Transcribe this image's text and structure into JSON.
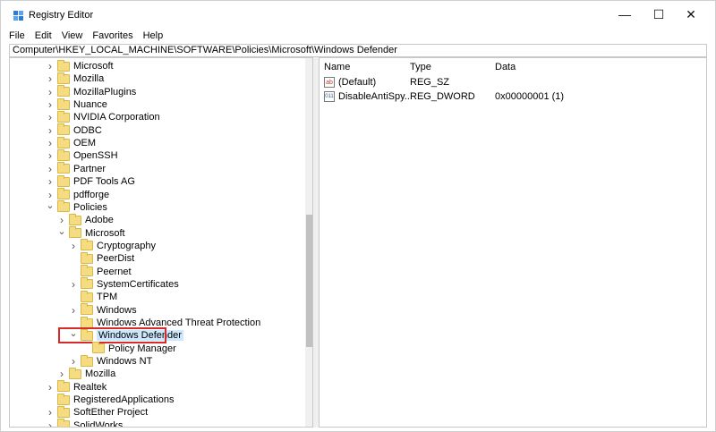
{
  "window": {
    "title": "Registry Editor",
    "controls": {
      "minimize": "—",
      "maximize": "☐",
      "close": "✕"
    }
  },
  "menu": [
    "File",
    "Edit",
    "View",
    "Favorites",
    "Help"
  ],
  "address": "Computer\\HKEY_LOCAL_MACHINE\\SOFTWARE\\Policies\\Microsoft\\Windows Defender",
  "tree": [
    {
      "label": "Microsoft",
      "level": 0,
      "expander": "collapsed"
    },
    {
      "label": "Mozilla",
      "level": 0,
      "expander": "collapsed"
    },
    {
      "label": "MozillaPlugins",
      "level": 0,
      "expander": "collapsed"
    },
    {
      "label": "Nuance",
      "level": 0,
      "expander": "collapsed"
    },
    {
      "label": "NVIDIA Corporation",
      "level": 0,
      "expander": "collapsed"
    },
    {
      "label": "ODBC",
      "level": 0,
      "expander": "collapsed"
    },
    {
      "label": "OEM",
      "level": 0,
      "expander": "collapsed"
    },
    {
      "label": "OpenSSH",
      "level": 0,
      "expander": "collapsed"
    },
    {
      "label": "Partner",
      "level": 0,
      "expander": "collapsed"
    },
    {
      "label": "PDF Tools AG",
      "level": 0,
      "expander": "collapsed"
    },
    {
      "label": "pdfforge",
      "level": 0,
      "expander": "collapsed"
    },
    {
      "label": "Policies",
      "level": 0,
      "expander": "expanded"
    },
    {
      "label": "Adobe",
      "level": 1,
      "expander": "collapsed"
    },
    {
      "label": "Microsoft",
      "level": 1,
      "expander": "expanded"
    },
    {
      "label": "Cryptography",
      "level": 2,
      "expander": "collapsed"
    },
    {
      "label": "PeerDist",
      "level": 2,
      "expander": "none"
    },
    {
      "label": "Peernet",
      "level": 2,
      "expander": "none"
    },
    {
      "label": "SystemCertificates",
      "level": 2,
      "expander": "collapsed"
    },
    {
      "label": "TPM",
      "level": 2,
      "expander": "none"
    },
    {
      "label": "Windows",
      "level": 2,
      "expander": "collapsed"
    },
    {
      "label": "Windows Advanced Threat Protection",
      "level": 2,
      "expander": "none"
    },
    {
      "label": "Windows Defender",
      "level": 2,
      "expander": "expanded",
      "selected": true
    },
    {
      "label": "Policy Manager",
      "level": 3,
      "expander": "none"
    },
    {
      "label": "Windows NT",
      "level": 2,
      "expander": "collapsed"
    },
    {
      "label": "Mozilla",
      "level": 1,
      "expander": "collapsed"
    },
    {
      "label": "Realtek",
      "level": 0,
      "expander": "collapsed"
    },
    {
      "label": "RegisteredApplications",
      "level": 0,
      "expander": "none"
    },
    {
      "label": "SoftEther Project",
      "level": 0,
      "expander": "collapsed"
    },
    {
      "label": "SolidWorks",
      "level": 0,
      "expander": "collapsed"
    }
  ],
  "values": {
    "columns": [
      "Name",
      "Type",
      "Data"
    ],
    "rows": [
      {
        "icon": "string-value-icon",
        "icon_text": "ab",
        "name": "(Default)",
        "type": "REG_SZ",
        "data": ""
      },
      {
        "icon": "binary-value-icon",
        "icon_text": "011",
        "name": "DisableAntiSpy...",
        "type": "REG_DWORD",
        "data": "0x00000001 (1)"
      }
    ]
  },
  "colors": {
    "highlight_border": "#d52b2b",
    "selection": "#cce8ff",
    "folder": "#f5dc82"
  }
}
